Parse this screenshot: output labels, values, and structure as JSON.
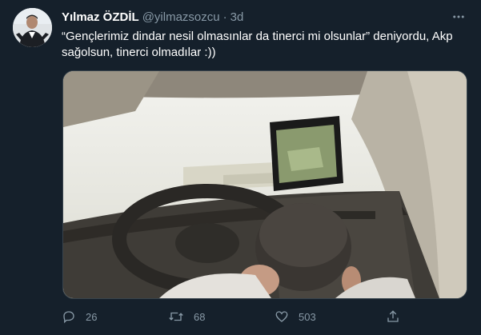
{
  "tweet": {
    "author_name": "Yılmaz ÖZDİL",
    "author_handle": "@yilmazsozcu",
    "separator": "·",
    "time": "3d",
    "text": "“Gençlerimiz dindar nesil olmasınlar da tinerci mi olsunlar” deniyordu, Akp sağolsun, tinerci olmadılar :))",
    "reply_count": "26",
    "retweet_count": "68",
    "like_count": "503"
  },
  "icons": {
    "more": "more-horizontal-icon",
    "reply": "reply-icon",
    "retweet": "retweet-icon",
    "like": "heart-icon",
    "share": "share-icon"
  },
  "colors": {
    "background": "#15202b",
    "text_primary": "#ffffff",
    "text_secondary": "#8899a6",
    "border": "#38444d"
  }
}
